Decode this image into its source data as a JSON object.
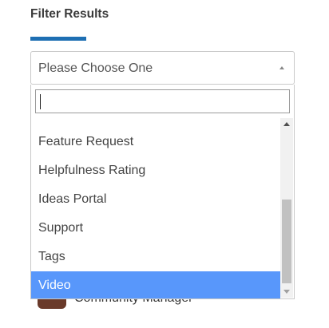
{
  "filter": {
    "title": "Filter Results",
    "accent_color": "#1e6fb3"
  },
  "select": {
    "value": "Please Choose One",
    "arrow_icon": "triangle-up-icon"
  },
  "dropdown": {
    "search_value": "",
    "options": [
      {
        "label": "Feature Request",
        "selected": false
      },
      {
        "label": "Helpfulness Rating",
        "selected": false
      },
      {
        "label": "Ideas Portal",
        "selected": false
      },
      {
        "label": "Support",
        "selected": false
      },
      {
        "label": "Tags",
        "selected": false
      },
      {
        "label": "Video",
        "selected": true
      }
    ],
    "selected_color": "#5897fb",
    "scroll_position": 0.55
  },
  "background_peek": {
    "text": "Community Manager"
  }
}
